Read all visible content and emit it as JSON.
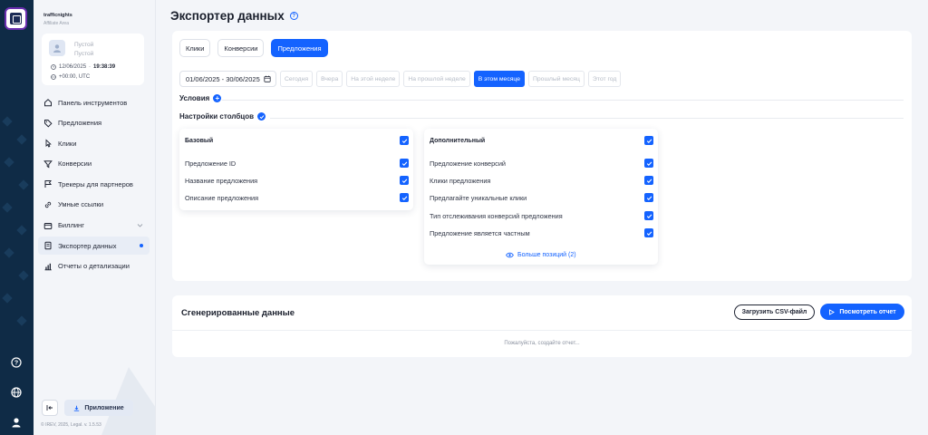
{
  "colors": {
    "accent": "#1463ff",
    "rail": "#0f2b46",
    "background": "#f3f5f9"
  },
  "rail": {
    "icons": [
      "app-logo-icon",
      "help-icon",
      "globe-icon",
      "user-icon"
    ]
  },
  "sidebar": {
    "brand": "trafficnights",
    "brand_sub": "Affiliate Area",
    "user": {
      "name": "Пустой",
      "role": "Пустой",
      "date": "12/06/2025",
      "time": "19:38:39",
      "timezone": "+00:00, UTC"
    },
    "items": [
      {
        "label": "Панель инструментов",
        "icon": "home-icon"
      },
      {
        "label": "Предложения",
        "icon": "tag-icon"
      },
      {
        "label": "Клики",
        "icon": "pointer-icon"
      },
      {
        "label": "Конверсии",
        "icon": "filter-icon"
      },
      {
        "label": "Трекеры для партнеров",
        "icon": "tracker-icon"
      },
      {
        "label": "Умные ссылки",
        "icon": "link-icon"
      },
      {
        "label": "Биллинг",
        "icon": "wallet-icon"
      },
      {
        "label": "Экспортер данных",
        "icon": "export-icon",
        "active": true
      },
      {
        "label": "Отчеты о детализации",
        "icon": "chart-icon"
      }
    ],
    "app_button": "Приложение",
    "copyright": "© IREV, 2025, Legal. v. 1.5.53"
  },
  "page": {
    "title": "Экспортер данных"
  },
  "tabs": [
    "Клики",
    "Конверсии",
    "Предложения"
  ],
  "active_tab": 2,
  "date_range": "01/06/2025 - 30/06/2025",
  "presets": [
    "Сегодня",
    "Вчера",
    "На этой неделе",
    "На прошлой неделе",
    "В этом месяце",
    "Прошлый месяц",
    "Этот год"
  ],
  "active_preset": 4,
  "conditions_label": "Условия",
  "columns_label": "Настройки столбцов",
  "basic": {
    "title": "Базовый",
    "rows": [
      "Предложение ID",
      "Название предложения",
      "Описание предложения"
    ]
  },
  "additional": {
    "title": "Дополнительный",
    "rows": [
      "Предложение конверсий",
      "Клики предложения",
      "Предлагайте уникальные клики",
      "Тип отслеживания конверсий предложения",
      "Предложение является частным"
    ],
    "more": "Больше позиций (2)"
  },
  "generated": {
    "title": "Сгенерированные данные",
    "csv_button": "Загрузить CSV-файл",
    "view_button": "Посмотреть отчет",
    "empty": "Пожалуйста, создайте отчет..."
  }
}
